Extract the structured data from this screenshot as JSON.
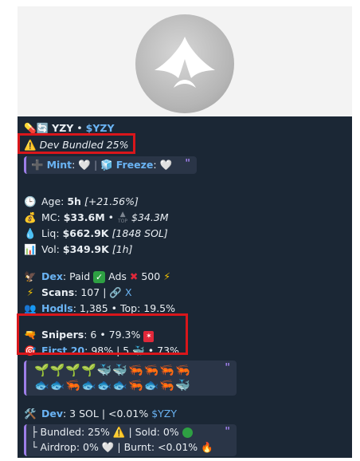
{
  "token": {
    "name": "YZY",
    "sep": "•",
    "ticker": "$YZY",
    "dev_bundled": "Dev Bundled 25%"
  },
  "flags": {
    "mint_label": "Mint",
    "mint_value": "🤍",
    "freeze_label": "Freeze",
    "freeze_value": "🤍",
    "quote_mark": "\""
  },
  "stats": {
    "age_label": "Age:",
    "age_value": "5h",
    "age_change": "[+21.56%]",
    "mc_label": "MC:",
    "mc_value": "$33.6M",
    "mc_sep": "•",
    "mc_top": "$34.3M",
    "top_label": "TOP",
    "liq_label": "Liq:",
    "liq_value": "$662.9K",
    "liq_sol": "[1848 SOL]",
    "vol_label": "Vol:",
    "vol_value": "$349.9K",
    "vol_period": "[1h]"
  },
  "dex": {
    "dex_label": "Dex",
    "dex_status": ": Paid",
    "ads_label": "Ads",
    "boost": "500",
    "scans_label": "Scans",
    "scans_value": ": 107 |",
    "x_label": "X",
    "hodls_label": "Hodls",
    "hodls_value": ": 1,385 • Top: 19.5%"
  },
  "snipers": {
    "snipers_label": "Snipers",
    "snipers_value": ": 6 • 79.3%",
    "first20_label": "First 20",
    "first20_value": ": 98% | 5",
    "first20_tail": "• 73%"
  },
  "holders_emojis": {
    "row1": "🌱🌱🌱🌱🐳🐳🦐🦐🦐🦐",
    "row2": "🐟🐟🦐🐟🐟🐟🦐🐟🦐🐳"
  },
  "dev": {
    "dev_label": "Dev",
    "dev_value": ": 3 SOL | <0.01%",
    "dev_ticker": "$YZY",
    "bundled": "├ Bundled: 25%",
    "sold": "| Sold: 0%",
    "airdrop": "└ Airdrop: 0%",
    "burnt": "| Burnt: <0.01%"
  },
  "colors": {
    "bg": "#1b2735",
    "link": "#6ab3f3",
    "quote_bar": "#9d7ee8",
    "highlight": "#d9161b"
  }
}
